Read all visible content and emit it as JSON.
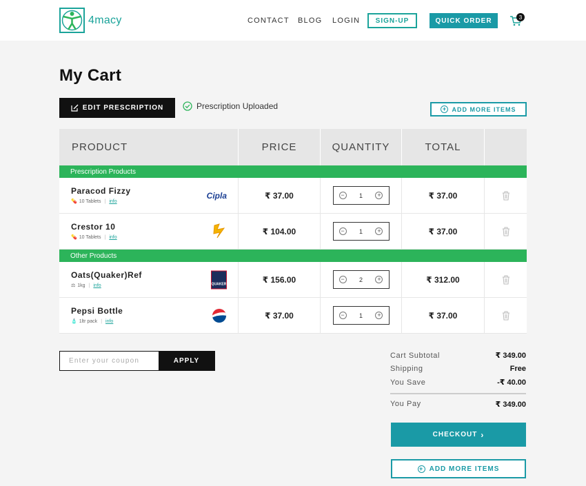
{
  "header": {
    "logo_text": "4macy",
    "nav": [
      "CONTACT",
      "BLOG",
      "LOGIN"
    ],
    "signup_label": "SIGN-UP",
    "quick_order_label": "QUICK ORDER",
    "cart_count": "3"
  },
  "page": {
    "title": "My Cart",
    "edit_prescription_label": "EDIT PRESCRIPTION",
    "prescription_status": "Prescription Uploaded",
    "add_more_items_label": "ADD MORE ITEMS"
  },
  "table": {
    "headers": [
      "PRODUCT",
      "PRICE",
      "QUANTITY",
      "TOTAL"
    ],
    "sections": [
      {
        "title": "Prescription Products",
        "items": [
          {
            "name": "Paracod Fizzy",
            "pack": "10 Tablets",
            "info": "info",
            "brand": "Cipla",
            "price": "₹ 37.00",
            "qty": "1",
            "total": "₹ 37.00"
          },
          {
            "name": "Crestor 10",
            "pack": "10 Tablets",
            "info": "info",
            "brand": "",
            "price": "₹ 104.00",
            "qty": "1",
            "total": "₹ 37.00"
          }
        ]
      },
      {
        "title": "Other Products",
        "items": [
          {
            "name": "Oats(Quaker)Ref",
            "pack": "1kg",
            "info": "info",
            "brand": "QUAKER",
            "price": "₹ 156.00",
            "qty": "2",
            "total": "₹ 312.00"
          },
          {
            "name": "Pepsi Bottle",
            "pack": "1ltr pack",
            "info": "info",
            "brand": "",
            "price": "₹ 37.00",
            "qty": "1",
            "total": "₹ 37.00"
          }
        ]
      }
    ]
  },
  "coupon": {
    "placeholder": "Enter your coupon",
    "apply_label": "APPLY"
  },
  "summary": {
    "subtotal_label": "Cart Subtotal",
    "subtotal": "₹ 349.00",
    "shipping_label": "Shipping",
    "shipping": "Free",
    "save_label": "You Save",
    "save": "-₹ 40.00",
    "pay_label": "You Pay",
    "pay": "₹ 349.00",
    "checkout_label": "CHECKOUT",
    "add_more_label": "ADD MORE ITEMS"
  },
  "colors": {
    "teal": "#1a9aa6",
    "green_section": "#2cb45a",
    "black": "#111111"
  }
}
